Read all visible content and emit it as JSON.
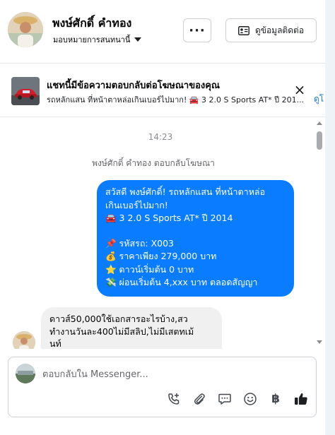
{
  "header": {
    "name": "พงษ์ศักดิ์ คำทอง",
    "assign_label": "มอบหมายการสนทนานี้",
    "more_label": "···",
    "contact_button": "ดูข้อมูลติดต่อ"
  },
  "ad_banner": {
    "title": "แชทนี้มีข้อความตอบกลับต่อโฆษณาของคุณ",
    "text": "รถหลักแสน ที่หน้าตาหล่อเกินเบอร์ไปมาก! 🚘 3 2.0 S Sports AT* ปี 201...",
    "close_label": "×",
    "link": "ดูโ"
  },
  "conversation": {
    "timestamp": "14:23",
    "reply_note": "พงษ์ศักดิ์ คำทอง ตอบกลับโฆษณา",
    "outgoing": {
      "line1": "สวัสดี พงษ์ศักดิ์! รถหลักแสน ที่หน้าตาหล่อ",
      "line2": "เกินเบอร์ไปมาก!",
      "line3": "🚘 3 2.0 S Sports AT* ปี 2014",
      "line4": "📌 รหัสรถ: X003",
      "line5": "💰 ราคาเพียง 279,000 บาท",
      "line6": "⭐ ดาวน์เริ่มต้น 0 บาท",
      "line7": "💸 ผ่อนเริ่มต้น 4,xxx บาท ตลอดสัญญา"
    },
    "incoming": {
      "line1": "ดาวส์50,000ใช้เอกสารอะไรบ้าง,สว",
      "line2": "ทำงานวันละ400ไม่มีสลิป,ไม่มีเสตทเม้",
      "line3": "นท์"
    }
  },
  "composer": {
    "placeholder": "ตอบกลับใน Messenger...",
    "baht_symbol": "฿"
  },
  "colors": {
    "brand_blue": "#0a7cff",
    "incoming_bg": "#f0f0f0",
    "link": "#1877f2"
  }
}
